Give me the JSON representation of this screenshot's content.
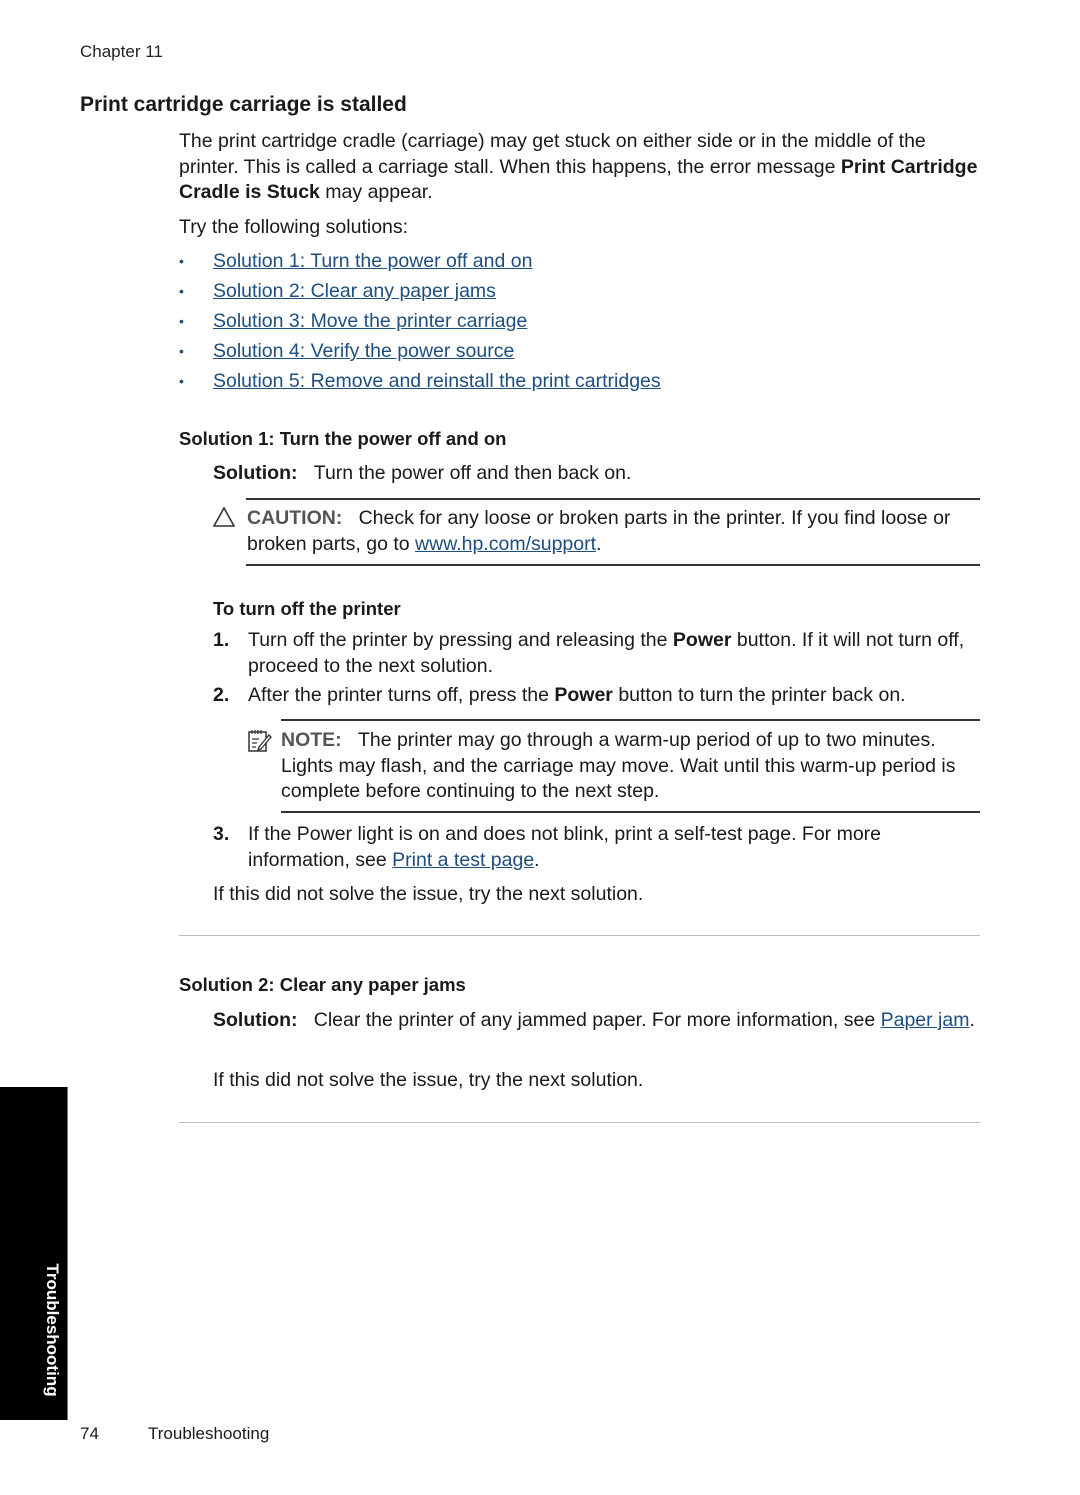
{
  "header": {
    "chapter": "Chapter 11"
  },
  "section": {
    "title": "Print cartridge carriage is stalled",
    "intro_1": "The print cartridge cradle (carriage) may get stuck on either side or in the middle of the printer. This is called a carriage stall. When this happens, the error message ",
    "intro_bold": "Print Cartridge Cradle is Stuck",
    "intro_2": " may appear.",
    "try_text": "Try the following solutions:",
    "solutions_links": [
      "Solution 1: Turn the power off and on",
      "Solution 2: Clear any paper jams",
      "Solution 3: Move the printer carriage",
      "Solution 4: Verify the power source",
      "Solution 5: Remove and reinstall the print cartridges"
    ],
    "bullet": "•"
  },
  "solution1": {
    "heading": "Solution 1: Turn the power off and on",
    "label": "Solution:",
    "text": "Turn the power off and then back on.",
    "caution": {
      "icon": "warning-triangle",
      "label": "CAUTION:",
      "text_1": "Check for any loose or broken parts in the printer. If you find loose or broken parts, go to ",
      "link": "www.hp.com/support",
      "text_2": "."
    },
    "procedure_heading": "To turn off the printer",
    "steps": [
      {
        "num": "1.",
        "pre": "Turn off the printer by pressing and releasing the ",
        "bold": "Power",
        "post": " button. If it will not turn off, proceed to the next solution."
      },
      {
        "num": "2.",
        "pre": "After the printer turns off, press the ",
        "bold": "Power",
        "post": " button to turn the printer back on."
      },
      {
        "num": "3.",
        "pre": "If the Power light is on and does not blink, print a self-test page. For more information, see ",
        "link": "Print a test page",
        "post": "."
      }
    ],
    "note": {
      "icon": "note-pencil",
      "label": "NOTE:",
      "text": "The printer may go through a warm-up period of up to two minutes. Lights may flash, and the carriage may move. Wait until this warm-up period is complete before continuing to the next step."
    },
    "next": "If this did not solve the issue, try the next solution."
  },
  "solution2": {
    "heading": "Solution 2: Clear any paper jams",
    "label": "Solution:",
    "text": "Clear the printer of any jammed paper. For more information, see ",
    "link": "Paper jam",
    "text_2": ".",
    "next": "If this did not solve the issue, try the next solution."
  },
  "side_tab": {
    "label": "Troubleshooting"
  },
  "footer": {
    "page_number": "74",
    "section": "Troubleshooting"
  }
}
